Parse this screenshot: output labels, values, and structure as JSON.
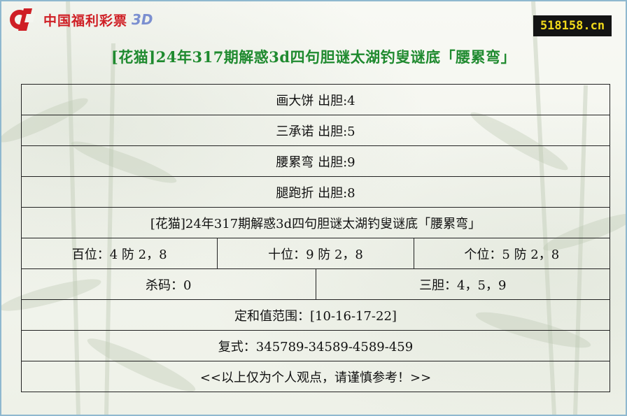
{
  "logo": {
    "text": "中国福利彩票",
    "suffix": "3D"
  },
  "site_badge": "518158.cn",
  "title": "[花猫]24年317期解惑3d四句胆谜太湖钓叟谜底「腰累弯」",
  "rows": [
    "画大饼 出胆:4",
    "三承诺 出胆:5",
    "腰累弯 出胆:9",
    "腿跑折 出胆:8",
    "[花猫]24年317期解惑3d四句胆谜太湖钓叟谜底「腰累弯」"
  ],
  "positions": [
    "百位：4 防 2，8",
    "十位：9 防 2，8",
    "个位：5 防 2，8"
  ],
  "kill_code": "杀码：0",
  "three_dan": "三胆：4，5，9",
  "sum_range": "定和值范围：[10-16-17-22]",
  "combo": "复式：345789-34589-4589-459",
  "disclaimer": "<<以上仅为个人观点，请谨慎参考！>>",
  "colors": {
    "title": "#1f8a2f",
    "logo": "#cf1f25",
    "badge_bg": "#141414",
    "badge_text": "#f1d91a",
    "border": "#8fb8cf"
  }
}
